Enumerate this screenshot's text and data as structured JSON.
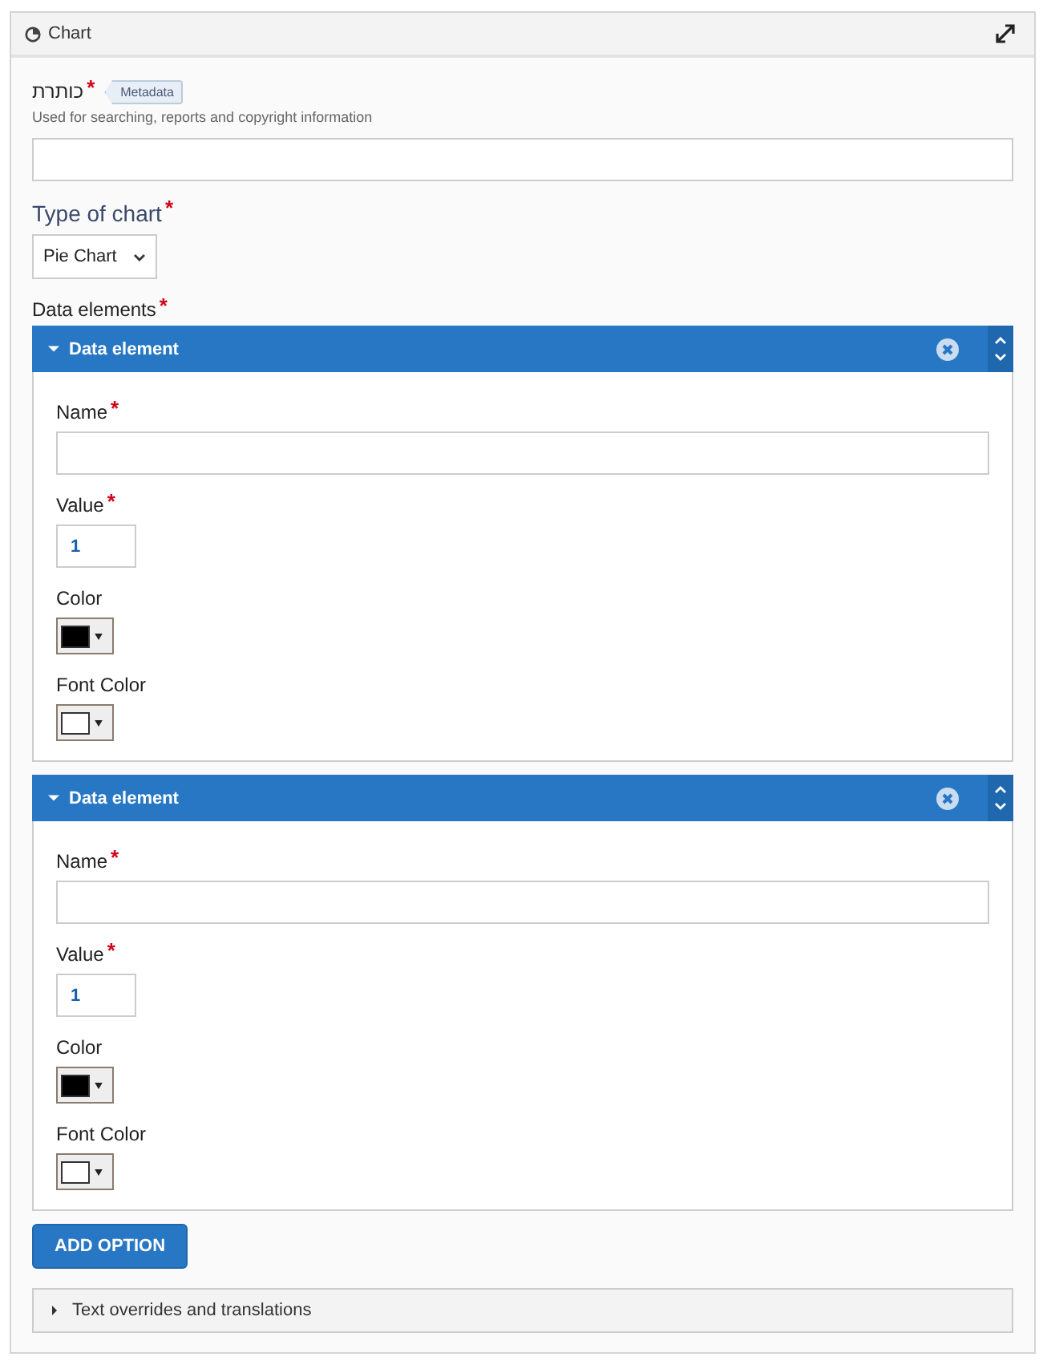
{
  "panel": {
    "title": "Chart"
  },
  "title_field": {
    "label": "כותרת",
    "required_mark": "*",
    "badge": "Metadata",
    "description": "Used for searching, reports and copyright information"
  },
  "chart_type": {
    "label": "Type of chart",
    "required_mark": "*",
    "value": "Pie Chart"
  },
  "data_elements": {
    "label": "Data elements",
    "required_mark": "*",
    "items": [
      {
        "title": "Data element",
        "expanded": true,
        "fields": [
          {
            "kind": "text",
            "label": "Name",
            "required_mark": "*"
          },
          {
            "kind": "number",
            "label": "Value",
            "required_mark": "*",
            "value": "1"
          },
          {
            "kind": "color",
            "label": "Color",
            "color": "#000000"
          },
          {
            "kind": "color",
            "label": "Font Color",
            "color": "#ffffff"
          }
        ]
      },
      {
        "title": "Data element",
        "expanded": true,
        "fields": [
          {
            "kind": "text",
            "label": "Name",
            "required_mark": "*"
          },
          {
            "kind": "number",
            "label": "Value",
            "required_mark": "*",
            "value": "1"
          },
          {
            "kind": "color",
            "label": "Color",
            "color": "#000000"
          },
          {
            "kind": "color",
            "label": "Font Color",
            "color": "#ffffff"
          }
        ]
      }
    ]
  },
  "add_button": "ADD OPTION",
  "overrides": {
    "title": "Text overrides and translations",
    "expanded": false
  }
}
